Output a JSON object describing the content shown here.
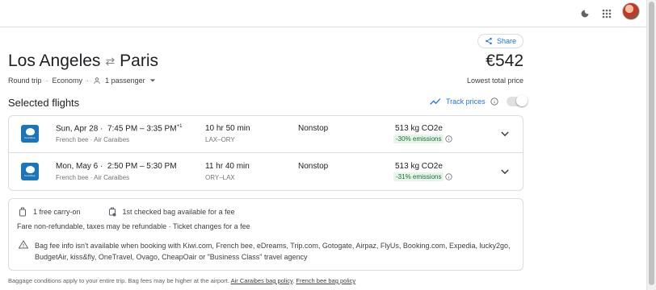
{
  "header": {
    "icons": [
      "dark-mode-moon-icon",
      "apps-grid-icon",
      "account-avatar"
    ]
  },
  "share": {
    "label": "Share",
    "icon": "share-icon"
  },
  "route": {
    "origin": "Los Angeles",
    "destination": "Paris",
    "arrow_icon": "round-trip-arrows-icon"
  },
  "price": {
    "value": "€542",
    "label": "Lowest total price"
  },
  "trip": {
    "type": "Round trip",
    "cabin": "Economy",
    "passengers": "1 passenger"
  },
  "selected": {
    "title": "Selected flights"
  },
  "track": {
    "label": "Track prices",
    "enabled": false
  },
  "flights": [
    {
      "date": "Sun, Apr 28",
      "depart": "7:45 PM",
      "arrive": "3:35 PM",
      "day_offset": "+1",
      "airlines": "French bee · Air Caraibes",
      "duration": "10 hr 50 min",
      "codes": "LAX–ORY",
      "stops": "Nonstop",
      "co2": "513 kg CO2e",
      "emissions": "-30% emissions"
    },
    {
      "date": "Mon, May 6",
      "depart": "2:50 PM",
      "arrive": "5:30 PM",
      "day_offset": "",
      "airlines": "French bee · Air Caraibes",
      "duration": "11 hr 40 min",
      "codes": "ORY–LAX",
      "stops": "Nonstop",
      "co2": "513 kg CO2e",
      "emissions": "-31% emissions"
    }
  ],
  "baggage": {
    "carry_on": "1 free carry-on",
    "checked": "1st checked bag available for a fee",
    "fare_note": "Fare non-refundable, taxes may be refundable · Ticket changes for a fee",
    "warning": "Bag fee info isn't available when booking with Kiwi.com, French bee, eDreams, Trip.com, Gotogate, Airpaz, FlyUs, Booking.com, Expedia, lucky2go, BudgetAir, kiss&fly, OneTravel, Ovago, CheapOair or \"Business Class\" travel agency"
  },
  "footer": {
    "text": "Baggage conditions apply to your entire trip. Bag fees may be higher at the airport.",
    "link1": "Air Caraibes bag policy",
    "separator": ",",
    "link2": "French bee bag policy"
  },
  "colors": {
    "accent": "#1a73e8",
    "emissions_green": "#137333",
    "emissions_bg": "#e6f4ea",
    "border": "#dadce0"
  }
}
